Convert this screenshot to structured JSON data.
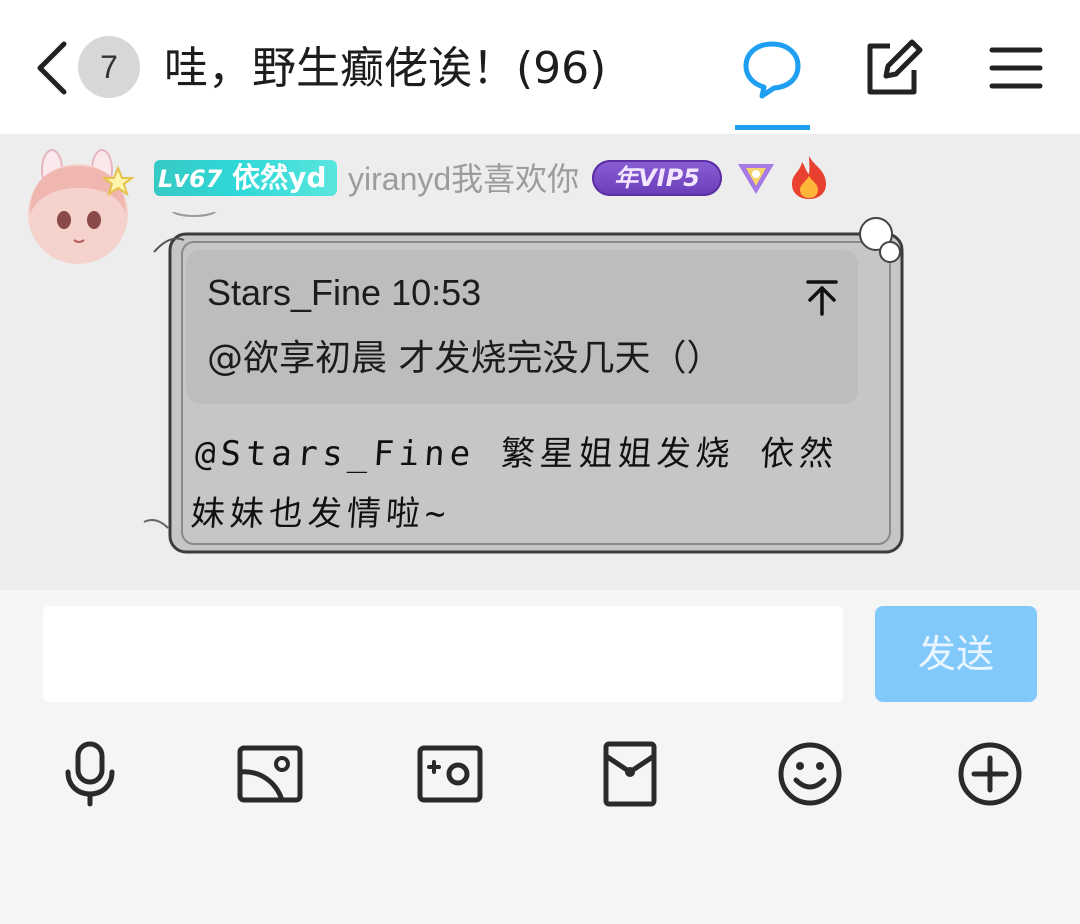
{
  "header": {
    "unread_count": "7",
    "title": "哇，野生癫佬诶！(96)",
    "tab_active_color": "#1e9ff2"
  },
  "message": {
    "level_prefix": "Lv67",
    "display_name": "依然yd",
    "username": "yiranyd我喜欢你",
    "vip_badge": "年VIP5",
    "quote": {
      "author_time": "Stars_Fine 10:53",
      "text": "@欲享初晨 才发烧完没几天（）",
      "pin_icon": "arrow-up-to-top-icon"
    },
    "reply_text": "@Stars_Fine 繁星姐姐发烧 依然妹妹也发情啦~"
  },
  "composer": {
    "input_value": "",
    "send_label": "发送",
    "send_color": "#82c9fb",
    "toolbar_icons": [
      "microphone-icon",
      "image-icon",
      "camera-icon",
      "red-packet-icon",
      "emoji-icon",
      "plus-icon"
    ]
  }
}
